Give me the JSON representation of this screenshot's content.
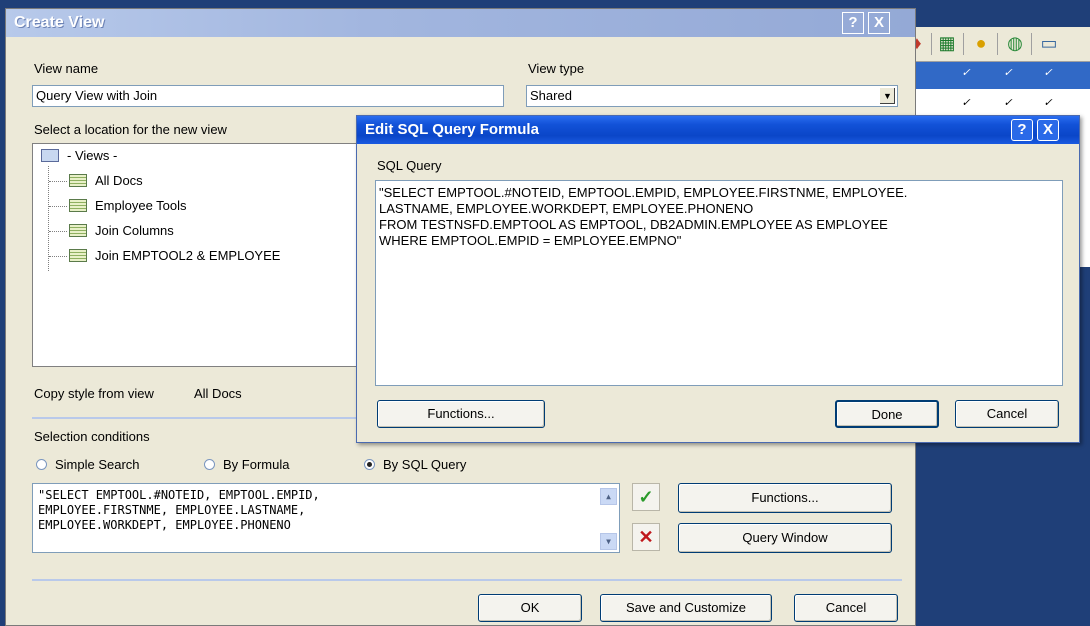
{
  "background_window": {
    "toolbar_icons": [
      "pin-icon",
      "grid-icon",
      "coin-icon",
      "globe-icon",
      "monitor-icon"
    ],
    "checkmark": "✓"
  },
  "create_view": {
    "title": "Create View",
    "help_btn": "?",
    "close_btn": "X",
    "view_name_label": "View name",
    "view_name_value": "Query View with Join",
    "view_type_label": "View type",
    "view_type_value": "Shared",
    "location_label": "Select a location for the new view",
    "tree": {
      "root": "- Views -",
      "items": [
        "All Docs",
        "Employee Tools",
        "Join Columns",
        "Join EMPTOOL2 & EMPLOYEE"
      ]
    },
    "copy_style_label": "Copy style from view",
    "copy_style_value": "All Docs",
    "selection_conditions_label": "Selection conditions",
    "radios": [
      {
        "label": "Simple Search",
        "selected": false
      },
      {
        "label": "By Formula",
        "selected": false
      },
      {
        "label": "By SQL Query",
        "selected": true
      }
    ],
    "formula_lines": [
      "\"SELECT EMPTOOL.#NOTEID, EMPTOOL.EMPID,",
      "EMPLOYEE.FIRSTNME, EMPLOYEE.LASTNAME,",
      "EMPLOYEE.WORKDEPT, EMPLOYEE.PHONENO"
    ],
    "accept_icon": "✓",
    "cancel_icon": "✕",
    "functions_button": "Functions...",
    "query_window_button": "Query Window",
    "ok_button": "OK",
    "save_customize_button": "Save and Customize",
    "cancel_button": "Cancel"
  },
  "sql_dialog": {
    "title": "Edit SQL Query Formula",
    "help_btn": "?",
    "close_btn": "X",
    "sql_label": "SQL Query",
    "query_lines": [
      "\"SELECT EMPTOOL.#NOTEID, EMPTOOL.EMPID, EMPLOYEE.FIRSTNME, EMPLOYEE.",
      "LASTNAME, EMPLOYEE.WORKDEPT, EMPLOYEE.PHONENO",
      "FROM TESTNSFD.EMPTOOL AS EMPTOOL, DB2ADMIN.EMPLOYEE AS EMPLOYEE",
      "WHERE EMPTOOL.EMPID = EMPLOYEE.EMPNO\""
    ],
    "functions_button": "Functions...",
    "done_button": "Done",
    "cancel_button": "Cancel"
  }
}
